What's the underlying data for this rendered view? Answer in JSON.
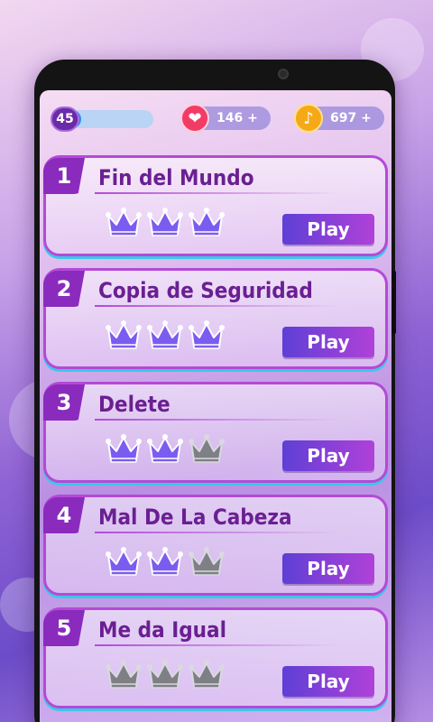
{
  "status_bar": {
    "level": "45",
    "level_progress": 0.2,
    "hearts": "146 +",
    "notes": "697 +",
    "heart_icon": "heart-icon",
    "note_icon": "music-note-icon"
  },
  "colors": {
    "crown_filled": "#7b5cf0",
    "crown_empty": "#7f7f86",
    "accent": "#8a2bbd",
    "play_start": "#5e3fd6",
    "play_end": "#b041d8"
  },
  "songs": [
    {
      "number": "1",
      "title": "Fin del Mundo",
      "crowns": 3,
      "play_label": "Play"
    },
    {
      "number": "2",
      "title": "Copia de Seguridad",
      "crowns": 3,
      "play_label": "Play"
    },
    {
      "number": "3",
      "title": "Delete",
      "crowns": 2,
      "play_label": "Play"
    },
    {
      "number": "4",
      "title": "Mal De La Cabeza",
      "crowns": 2,
      "play_label": "Play"
    },
    {
      "number": "5",
      "title": "Me da Igual",
      "crowns": 0,
      "play_label": "Play"
    }
  ]
}
